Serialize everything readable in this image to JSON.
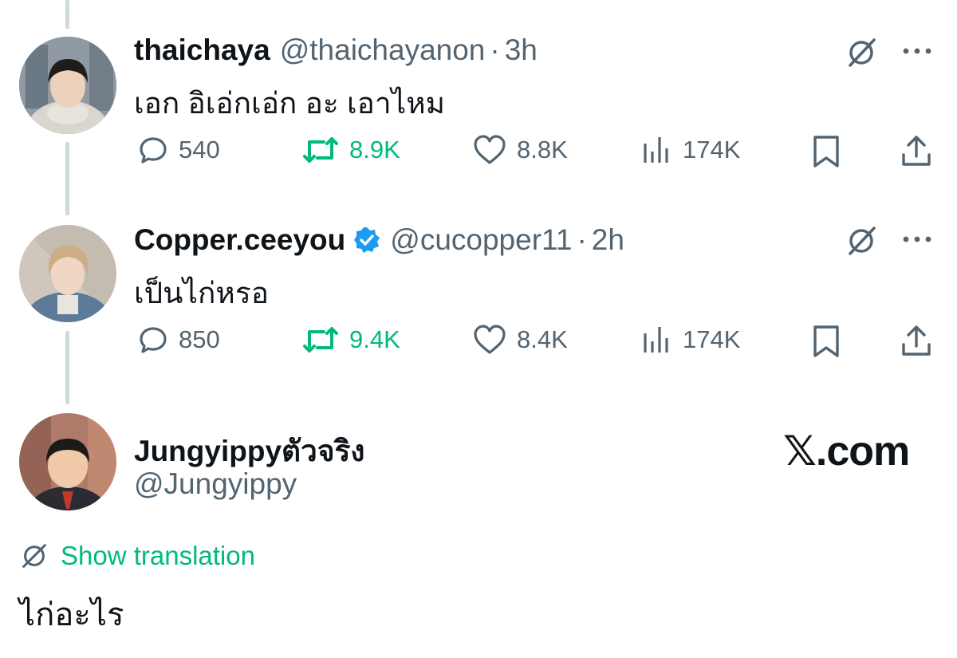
{
  "tweets": [
    {
      "display_name": "thaichaya",
      "handle": "@thaichayanon",
      "separator": "·",
      "time": "3h",
      "text": "เอก อิเอ่กเอ่ก อะ เอาไหม",
      "stats": {
        "replies": "540",
        "reposts": "8.9K",
        "likes": "8.8K",
        "views": "174K"
      },
      "reposted": true
    },
    {
      "display_name": "Copper.ceeyou",
      "handle": "@cucopper11",
      "separator": "·",
      "time": "2h",
      "verified": true,
      "text": "เป็นไก่หรอ",
      "stats": {
        "replies": "850",
        "reposts": "9.4K",
        "likes": "8.4K",
        "views": "174K"
      },
      "reposted": true
    }
  ],
  "main_post": {
    "display_name": "Jungyippyตัวจริง",
    "handle": "@Jungyippy",
    "translation_label": "Show translation",
    "text": "ไก่อะไร"
  },
  "watermark": "𝕏.com",
  "colors": {
    "text": "#0f1419",
    "secondary": "#536471",
    "repost_green": "#00ba7c",
    "verified_blue": "#1d9bf0",
    "thread_line": "#cfd9de"
  },
  "icons": [
    "reply-icon",
    "repost-icon",
    "like-icon",
    "views-icon",
    "bookmark-icon",
    "share-icon",
    "grok-icon",
    "more-icon",
    "verified-badge-icon",
    "translate-icon"
  ]
}
